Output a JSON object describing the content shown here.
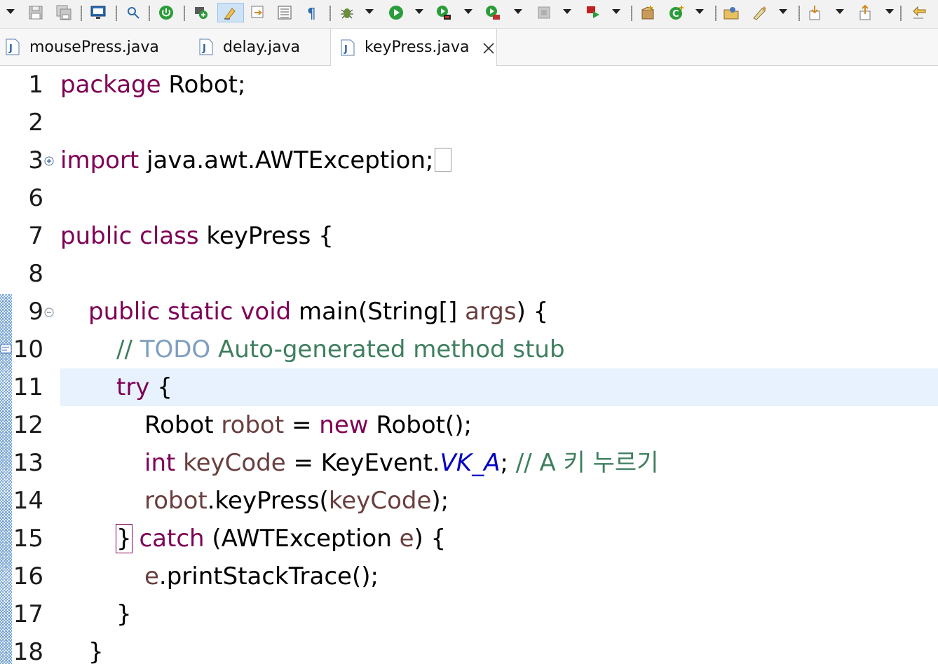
{
  "toolbar": {
    "buttons": [
      {
        "name": "view-menu-dropdown",
        "icon": "chevron-down-icon"
      },
      {
        "name": "save-button",
        "icon": "save-icon"
      },
      {
        "name": "save-all-button",
        "icon": "save-all-icon"
      },
      {
        "name": "terminal-button",
        "icon": "monitor-icon"
      },
      {
        "name": "search-button",
        "icon": "search-icon"
      },
      {
        "name": "spring-boot-button",
        "icon": "power-icon"
      },
      {
        "name": "new-project-button",
        "icon": "new-project-icon"
      },
      {
        "name": "mark-occurrences-button",
        "icon": "highlighter-icon"
      },
      {
        "name": "link-editor-button",
        "icon": "link-editor-icon"
      },
      {
        "name": "block-selection-button",
        "icon": "block-selection-icon"
      },
      {
        "name": "show-whitespace-button",
        "icon": "pilcrow-icon"
      },
      {
        "name": "debug-button",
        "icon": "bug-icon"
      },
      {
        "name": "run-button",
        "icon": "play-icon"
      },
      {
        "name": "coverage-button",
        "icon": "coverage-icon"
      },
      {
        "name": "external-tools-button",
        "icon": "external-tools-icon"
      },
      {
        "name": "stop-button",
        "icon": "stop-icon"
      },
      {
        "name": "server-run-button",
        "icon": "server-icon"
      },
      {
        "name": "new-java-package-button",
        "icon": "package-icon"
      },
      {
        "name": "new-java-class-button",
        "icon": "new-class-icon"
      },
      {
        "name": "open-type-button",
        "icon": "open-type-icon"
      },
      {
        "name": "open-task-button",
        "icon": "pen-icon"
      },
      {
        "name": "next-annotation-button",
        "icon": "arrow-down-icon"
      },
      {
        "name": "previous-annotation-button",
        "icon": "arrow-up-icon"
      },
      {
        "name": "last-edit-button",
        "icon": "back-arrow-icon"
      }
    ]
  },
  "tabs": [
    {
      "label": "mousePress.java",
      "active": false
    },
    {
      "label": "delay.java",
      "active": false
    },
    {
      "label": "keyPress.java",
      "active": true
    }
  ],
  "editor": {
    "current_line": "11",
    "lines": [
      {
        "num": "1",
        "text": "package Robot;"
      },
      {
        "num": "2",
        "text": ""
      },
      {
        "num": "3",
        "text": "import java.awt.AWTException;"
      },
      {
        "num": "6",
        "text": ""
      },
      {
        "num": "7",
        "text": "public class keyPress {"
      },
      {
        "num": "8",
        "text": ""
      },
      {
        "num": "9",
        "text": "public static void main(String[] args) {"
      },
      {
        "num": "10",
        "text": "// TODO Auto-generated method stub"
      },
      {
        "num": "11",
        "text": "try {"
      },
      {
        "num": "12",
        "text": "Robot robot = new Robot();"
      },
      {
        "num": "13",
        "text": "int keyCode = KeyEvent.VK_A; // A 키 누르기"
      },
      {
        "num": "14",
        "text": "robot.keyPress(keyCode);"
      },
      {
        "num": "15",
        "text": "} catch (AWTException e) {"
      },
      {
        "num": "16",
        "text": "e.printStackTrace();"
      },
      {
        "num": "17",
        "text": "}"
      },
      {
        "num": "18",
        "text": "}"
      }
    ],
    "tokens": {
      "l1": [
        "package",
        " Robot;"
      ],
      "l3": [
        "import",
        " java.awt.AWTException;"
      ],
      "l7": [
        "public",
        " ",
        "class",
        " keyPress {"
      ],
      "l9": [
        "public",
        " ",
        "static",
        " ",
        "void",
        " main(String[] ",
        "args",
        ") {"
      ],
      "l10": [
        "// ",
        "TODO",
        " Auto-generated method stub"
      ],
      "l11": [
        "try",
        " {"
      ],
      "l12": [
        "Robot ",
        "robot",
        " = ",
        "new",
        " Robot();"
      ],
      "l13": [
        "int",
        " ",
        "keyCode",
        " = KeyEvent.",
        "VK_A",
        "; ",
        "// A 키 누르기"
      ],
      "l14": [
        "robot",
        ".keyPress(",
        "keyCode",
        ");"
      ],
      "l15": [
        "}",
        " ",
        "catch",
        " (AWTException ",
        "e",
        ") {"
      ],
      "l16": [
        "e",
        ".printStackTrace();"
      ],
      "l17": [
        "}"
      ],
      "l18": [
        "}"
      ]
    }
  },
  "colors": {
    "keyword": "#7f0055",
    "local_variable": "#6a3e3e",
    "comment": "#3f7f5f",
    "task_tag": "#7f9fbf",
    "static_constant": "#0000c0",
    "current_line": "#e8f2fe"
  }
}
